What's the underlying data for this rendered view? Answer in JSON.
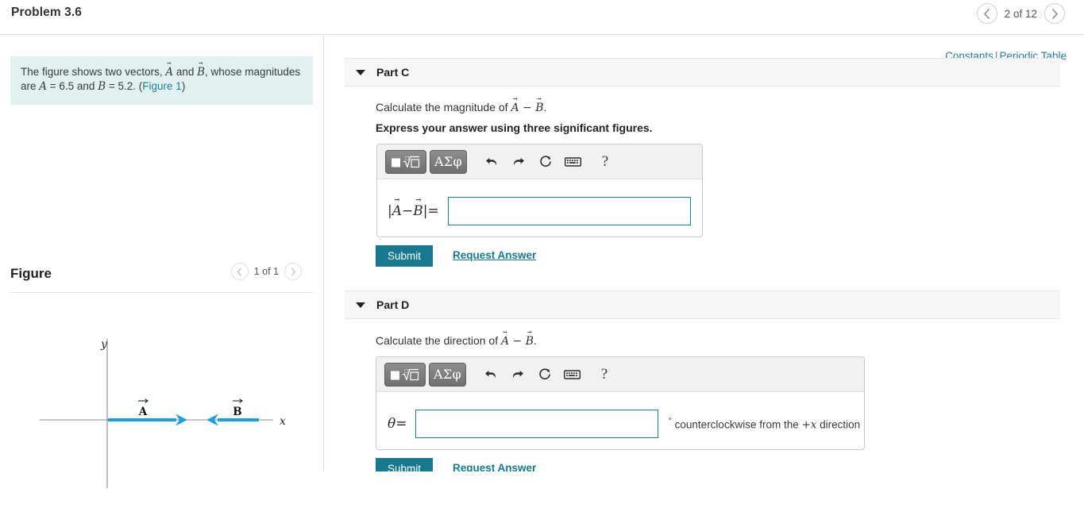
{
  "header": {
    "problem_title": "Problem 3.6",
    "pager_label": "2 of 12",
    "prev_icon": "chevron-left-icon",
    "next_icon": "chevron-right-icon"
  },
  "statement": {
    "text_part1": "The figure shows two vectors, ",
    "vec_a": "A",
    "text_and": " and ",
    "vec_b": "B",
    "text_part2": ", whose magnitudes are ",
    "var_a": "A",
    "a_value": " = 6.5 and ",
    "var_b": "B",
    "b_value": " = 5.2. (",
    "figure_link": "Figure 1",
    "text_end": ")"
  },
  "figure": {
    "title": "Figure",
    "pager_label": "1 of 1",
    "prev_icon": "chevron-left-icon",
    "next_icon": "chevron-right-icon",
    "axis_x_label": "x",
    "axis_y_label": "y",
    "vector_a_label": "A",
    "vector_b_label": "B",
    "vector_color": "#1b9fdd",
    "axis_color": "#8a8a8a"
  },
  "links": {
    "constants": "Constants",
    "separator": "|",
    "periodic_table": "Periodic Table"
  },
  "parts": [
    {
      "label": "Part C",
      "caret_icon": "caret-down-icon",
      "prompt_prefix": "Calculate the magnitude of ",
      "prompt_vec1": "A",
      "prompt_minus": " − ",
      "prompt_vec2": "B",
      "prompt_suffix": ".",
      "instruction": "Express your answer using three significant figures.",
      "lhs_bar_open": "|",
      "lhs_vec1": "A",
      "lhs_minus": " − ",
      "lhs_vec2": "B",
      "lhs_bar_close": "|",
      "lhs_equals": " =",
      "input_value": "",
      "input_placeholder": "",
      "submit_label": "Submit",
      "request_label": "Request Answer",
      "toolbar": {
        "math_template_button": "math-template-icon",
        "greek_button": "ΑΣφ",
        "undo_icon": "undo-arrow-icon",
        "redo_icon": "redo-arrow-icon",
        "reset_icon": "reset-circular-arrow-icon",
        "keyboard_icon": "keyboard-icon",
        "help_label": "?"
      }
    },
    {
      "label": "Part D",
      "caret_icon": "caret-down-icon",
      "prompt_prefix": "Calculate the direction of ",
      "prompt_vec1": "A",
      "prompt_minus": " − ",
      "prompt_vec2": "B",
      "prompt_suffix": ".",
      "instruction": "",
      "lhs_theta": "θ",
      "lhs_equals": " =",
      "input_value": "",
      "input_placeholder": "",
      "unit_degree": "°",
      "unit_text_before": " counterclockwise from the ",
      "unit_plus": "+",
      "unit_axis": "x",
      "unit_text_after": " direction",
      "submit_label": "Submit",
      "request_label": "Request Answer",
      "toolbar": {
        "math_template_button": "math-template-icon",
        "greek_button": "ΑΣφ",
        "undo_icon": "undo-arrow-icon",
        "redo_icon": "redo-arrow-icon",
        "reset_icon": "reset-circular-arrow-icon",
        "keyboard_icon": "keyboard-icon",
        "help_label": "?"
      }
    }
  ],
  "colors": {
    "accent_teal": "#16798f",
    "statement_bg": "#e1f1ef",
    "part_header_bg": "#f6f6f6",
    "input_border": "#1b7f95",
    "vector_blue": "#1b9fdd"
  }
}
